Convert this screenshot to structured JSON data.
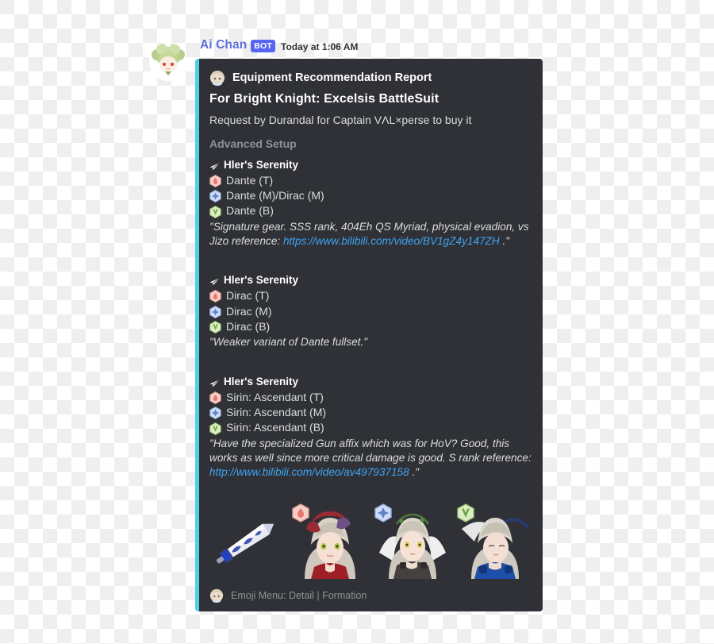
{
  "message": {
    "author": "Ai Chan",
    "bot_tag": "BOT",
    "timestamp": "Today at 1:06 AM",
    "author_color": "#5a6fd8",
    "avatar_icon": "anime-chibi-avatar"
  },
  "embed": {
    "accent_color": "#4fd0e7",
    "background_color": "#2f3136",
    "author": {
      "icon": "bot-avatar-icon",
      "name": "Equipment Recommendation Report"
    },
    "title": "For Bright Knight: Excelsis BattleSuit",
    "description": "Request by Durandal for Captain VΛL×perse to buy it",
    "section_heading": "Advanced Setup",
    "fields": [
      {
        "name": "Hler's Serenity",
        "icon": "paper-plane-icon",
        "gear": [
          {
            "slot": "T",
            "badge": "top-stigmata-icon",
            "badge_color": "#f0a7a0",
            "label": "Dante (T)"
          },
          {
            "slot": "M",
            "badge": "mid-stigmata-icon",
            "badge_color": "#a9c4ef",
            "label": "Dante (M)/Dirac (M)"
          },
          {
            "slot": "B",
            "badge": "bottom-stigmata-icon",
            "badge_color": "#b9dba0",
            "label": "Dante (B)"
          }
        ],
        "quote_before": "\"Signature gear. SSS rank, 404Eh QS Myriad, physical evadion, vs Jizo reference: ",
        "link": "https://www.bilibili.com/video/BV1gZ4y147ZH",
        "quote_after": " .\""
      },
      {
        "name": "Hler's Serenity",
        "icon": "paper-plane-icon",
        "gear": [
          {
            "slot": "T",
            "badge": "top-stigmata-icon",
            "badge_color": "#f0a7a0",
            "label": "Dirac (T)"
          },
          {
            "slot": "M",
            "badge": "mid-stigmata-icon",
            "badge_color": "#a9c4ef",
            "label": "Dirac (M)"
          },
          {
            "slot": "B",
            "badge": "bottom-stigmata-icon",
            "badge_color": "#b9dba0",
            "label": "Dirac (B)"
          }
        ],
        "quote_before": "\"Weaker variant of Dante fullset.\"",
        "link": "",
        "quote_after": ""
      },
      {
        "name": "Hler's Serenity",
        "icon": "paper-plane-icon",
        "gear": [
          {
            "slot": "T",
            "badge": "top-stigmata-icon",
            "badge_color": "#f0a7a0",
            "label": "Sirin: Ascendant (T)"
          },
          {
            "slot": "M",
            "badge": "mid-stigmata-icon",
            "badge_color": "#a9c4ef",
            "label": "Sirin: Ascendant (M)"
          },
          {
            "slot": "B",
            "badge": "bottom-stigmata-icon",
            "badge_color": "#b9dba0",
            "label": "Sirin: Ascendant (B)"
          }
        ],
        "quote_before": "\"Have the specialized Gun affix which was for HoV? Good, this works as well since more critical damage is good. S rank reference: ",
        "link": "http://www.bilibili.com/video/av497937158",
        "quote_after": " .\""
      }
    ],
    "gallery": [
      {
        "name": "weapon-hlers-serenity",
        "badge": "none"
      },
      {
        "name": "stigmata-top-portrait",
        "badge": "top-stigmata-icon",
        "badge_color": "#f0a7a0"
      },
      {
        "name": "stigmata-mid-portrait",
        "badge": "mid-stigmata-icon",
        "badge_color": "#a9c4ef"
      },
      {
        "name": "stigmata-bottom-portrait",
        "badge": "bottom-stigmata-icon",
        "badge_color": "#b9dba0"
      }
    ],
    "footer": {
      "icon": "bot-avatar-icon",
      "text": "Emoji Menu: Detail | Formation"
    }
  }
}
